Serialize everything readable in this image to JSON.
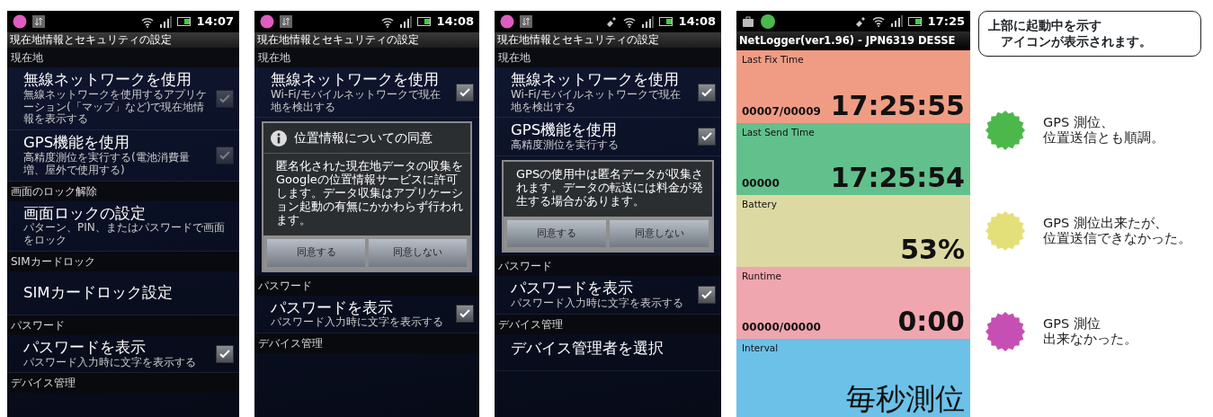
{
  "screens": [
    {
      "kind": "settings",
      "status_bar": {
        "time": "14:07",
        "gps": false
      },
      "title": "現在地情報とセキュリティの設定",
      "rows": [
        {
          "kind": "header",
          "text": "現在地"
        },
        {
          "kind": "check",
          "title": "無線ネットワークを使用",
          "summary": "無線ネットワークを使用するアプリケーション(「マップ」など)で現在地情報を表示する",
          "checked": true,
          "disabled": true
        },
        {
          "kind": "check",
          "title": "GPS機能を使用",
          "summary": "高精度測位を実行する(電池消費量増、屋外で使用する)",
          "checked": true,
          "disabled": true
        },
        {
          "kind": "header",
          "text": "画面のロック解除"
        },
        {
          "kind": "plain",
          "title": "画面ロックの設定",
          "summary": "パターン、PIN、またはパスワードで画面をロック"
        },
        {
          "kind": "header",
          "text": "SIMカードロック"
        },
        {
          "kind": "plain",
          "title": "SIMカードロック設定"
        },
        {
          "kind": "header",
          "text": "パスワード"
        },
        {
          "kind": "check",
          "title": "パスワードを表示",
          "summary": "パスワード入力時に文字を表示する",
          "checked": true,
          "disabled": false
        },
        {
          "kind": "header",
          "text": "デバイス管理"
        }
      ]
    },
    {
      "kind": "settings",
      "status_bar": {
        "time": "14:08",
        "gps": false
      },
      "title": "現在地情報とセキュリティの設定",
      "rows": [
        {
          "kind": "header",
          "text": "現在地"
        },
        {
          "kind": "check",
          "title": "無線ネットワークを使用",
          "summary": "Wi-Fi/モバイルネットワークで現在地を検出する",
          "checked": true,
          "disabled": false
        },
        {
          "kind": "dialog",
          "title": "位置情報についての同意",
          "message": "匿名化された現在地データの収集をGoogleの位置情報サービスに許可します。データ収集はアプリケーション起動の有無にかかわらず行われます。",
          "buttons": [
            "同意する",
            "同意しない"
          ]
        },
        {
          "kind": "header",
          "text": "パスワード"
        },
        {
          "kind": "check",
          "title": "パスワードを表示",
          "summary": "パスワード入力時に文字を表示する",
          "checked": true,
          "disabled": false
        },
        {
          "kind": "header",
          "text": "デバイス管理"
        }
      ]
    },
    {
      "kind": "settings",
      "status_bar": {
        "time": "14:08",
        "gps": true
      },
      "title": "現在地情報とセキュリティの設定",
      "rows": [
        {
          "kind": "header",
          "text": "現在地"
        },
        {
          "kind": "check",
          "title": "無線ネットワークを使用",
          "summary": "Wi-Fi/モバイルネットワークで現在地を検出する",
          "checked": true,
          "disabled": false
        },
        {
          "kind": "check",
          "title": "GPS機能を使用",
          "summary": "高精度測位を実行する",
          "checked": true,
          "disabled": false
        },
        {
          "kind": "dialog",
          "message": "GPSの使用中は匿名データが収集されます。データの転送には料金が発生する場合があります。",
          "buttons": [
            "同意する",
            "同意しない"
          ]
        },
        {
          "kind": "header",
          "text": "パスワード"
        },
        {
          "kind": "check",
          "title": "パスワードを表示",
          "summary": "パスワード入力時に文字を表示する",
          "checked": true,
          "disabled": false
        },
        {
          "kind": "header",
          "text": "デバイス管理"
        },
        {
          "kind": "plain",
          "title": "デバイス管理者を選択"
        }
      ]
    },
    {
      "kind": "logger",
      "status_bar": {
        "time": "17:25",
        "gps": true
      },
      "title": "NetLogger(ver1.96) - JPN6319 DESSE",
      "panels": [
        {
          "label": "Last Fix Time",
          "count": "00007/00009",
          "value": "17:25:55",
          "color": "#f09c84"
        },
        {
          "label": "Last Send Time",
          "count": "00000",
          "value": "17:25:54",
          "color": "#62c08c"
        },
        {
          "label": "Battery",
          "value": "53%",
          "color": "#dcd9a3"
        },
        {
          "label": "Runtime",
          "count": "00000/00000",
          "value": "0:00",
          "color": "#f0a6ae"
        },
        {
          "label": "Interval",
          "value": "毎秒測位",
          "color": "#6cc1e8"
        }
      ]
    }
  ],
  "legend": {
    "callout": [
      "上部に起動中を示す",
      "アイコンが表示されます。"
    ],
    "items": [
      {
        "lines": [
          "GPS 測位、",
          "位置送信とも順調。"
        ],
        "color": "#4cb84c"
      },
      {
        "lines": [
          "GPS 測位出来たが、",
          "位置送信できなかった。"
        ],
        "color": "#e3e07a"
      },
      {
        "lines": [
          "GPS 測位",
          "出来なかった。"
        ],
        "color": "#c64fb3"
      }
    ]
  }
}
